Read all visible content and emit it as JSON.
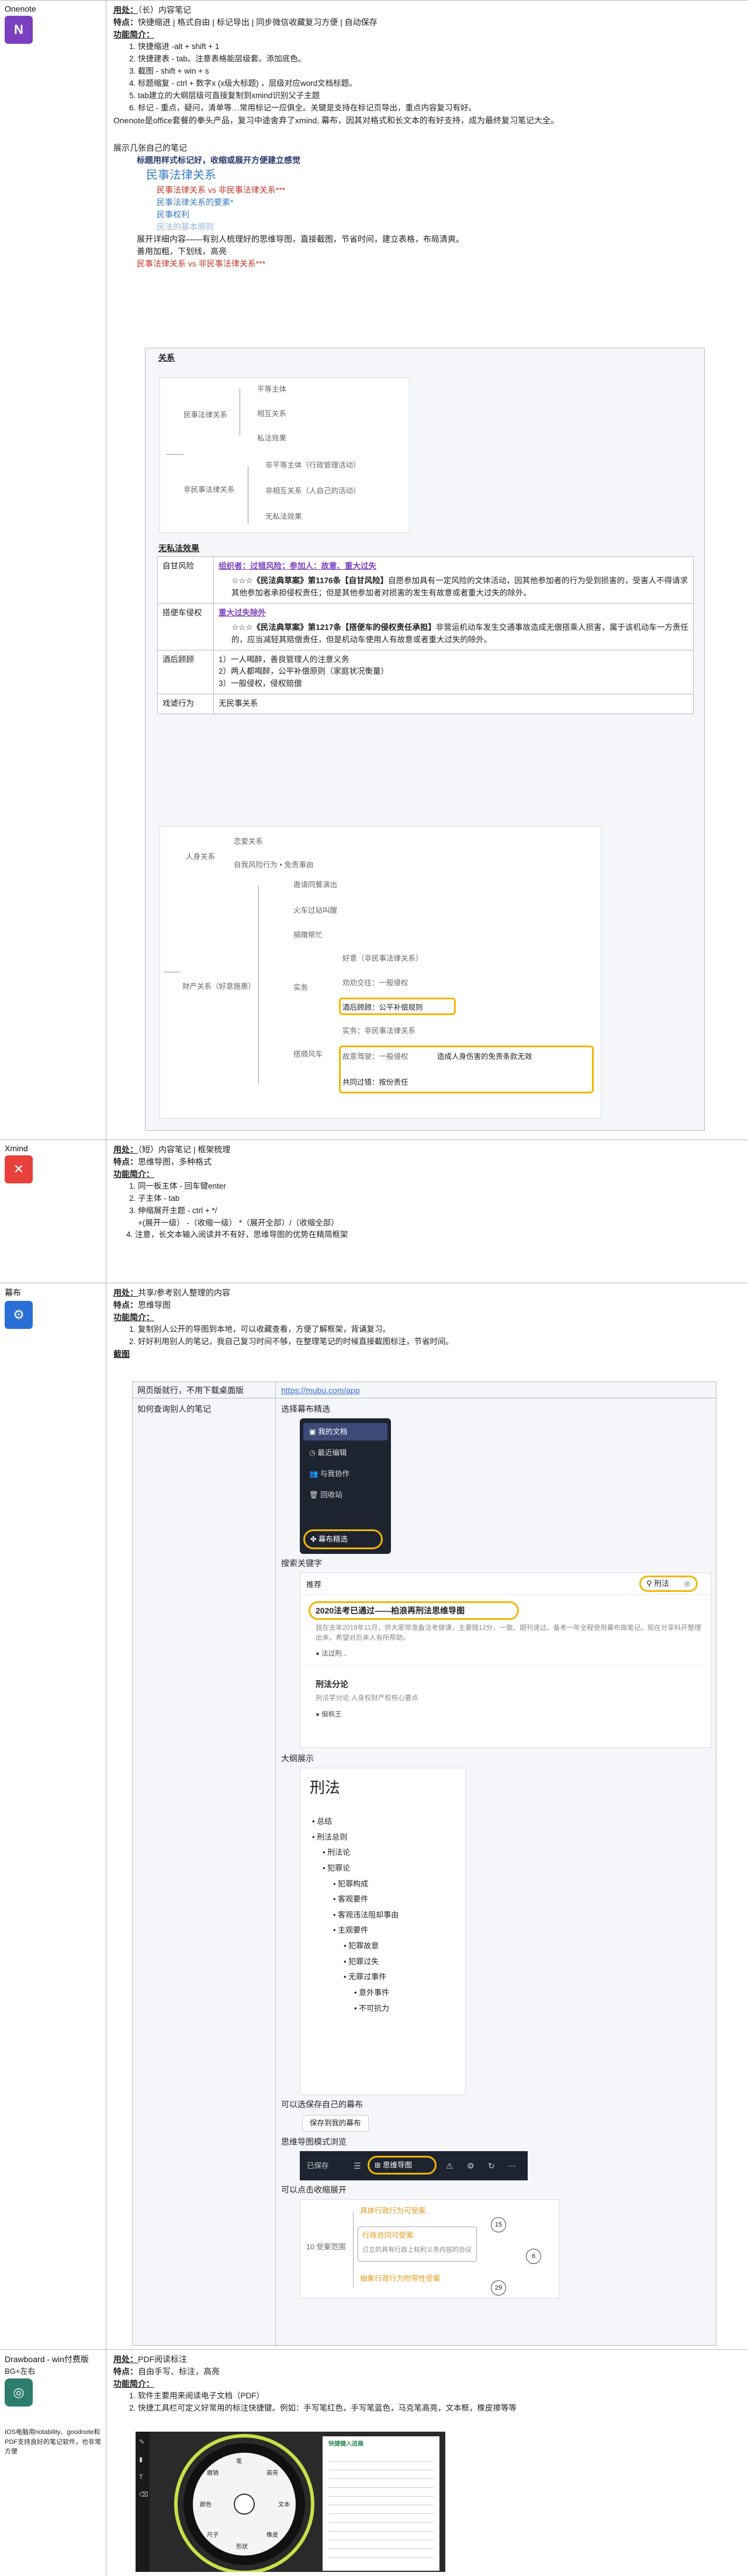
{
  "onenote": {
    "name": "Onenote",
    "icon_letter": "N",
    "usage_label": "用处：",
    "usage": "（长）内容笔记",
    "feature_label": "特点：",
    "feature": "快捷缩进 | 格式自由 | 标记导出 | 同步微信收藏复习方便 | 自动保存",
    "intro_label": "功能简介：",
    "items": [
      "快捷缩进 -alt + shift + 1",
      "快捷建表 - tab。注意表格能层级套。添加底色。",
      "截图 - shift + win + s",
      "标题缩复 - ctrl + 数字x (x级大标题) ，层级对应word文档标题。",
      "tab建立的大纲层级可直接复制到xmind识别父子主题",
      "标记 - 重点，疑问，清单等…常用标记一应俱全。关键是支持在标记页导出，重点内容复习有好。"
    ],
    "summary": "Onenote是office套餐的拳头产品，复习中途舍弃了xmind, 幕布，因其对格式和长文本的有好支持，成为最终复习笔记大全。",
    "demo_title": "展示几张自己的笔记",
    "demo_sub": "标题用样式标记好，收缩或展开方便建立感觉",
    "h1": "民事法律关系",
    "h2a": "民事法律关系 vs 非民事法律关系***",
    "h2b": "民事法律关系的要素*",
    "h2c": "民事权利",
    "h2d": "民法的基本原则",
    "para1": "展开详细内容——有别人梳理好的思维导图，直接截图，节省时间，建立表格，布局清爽。",
    "para2": "善用加粗，下划线，高亮",
    "h3": "民事法律关系 vs 非民事法律关系***",
    "t_rel": "关系",
    "mm1": {
      "root_a": "民事法律关系",
      "root_b": "非民事法律关系",
      "a1": "平等主体",
      "a2": "相互关系",
      "a3": "私法效果",
      "b1": "非平等主体（行政管理活动）",
      "b2": "非相互关系（人自己的活动）",
      "b3": "无私法效果"
    },
    "t_none": "无私法效果",
    "rows": [
      {
        "k": "自甘风险",
        "tag": "组织者：过错风险；参加人：故意、重大过失",
        "body_b": "☆☆☆《民法典草案》第1176条【自甘风险】",
        "body": "自愿参加具有一定风险的文体活动，因其他参加者的行为受到损害的，受害人不得请求其他参加者承担侵权责任；但是其他参加者对损害的发生有故意或者重大过失的除外。"
      },
      {
        "k": "搭便车侵权",
        "tag": "重大过失除外",
        "body_b": "☆☆☆《民法典草案》第1217条【搭便车的侵权责任承担】",
        "body": "非营运机动车发生交通事故造成无偿搭乘人损害，属于该机动车一方责任的，应当减轻其赔偿责任，但是机动车使用人有故意或者重大过失的除外。"
      },
      {
        "k": "酒后顾顾",
        "lines": [
          "1）一人喝醉，善良管理人的注意义务",
          "2）两人都喝醉，公平补偿原则（家庭状况衡量）",
          "3）一般侵权，侵权赔偿"
        ]
      },
      {
        "k": "戏谑行为",
        "plain": "无民事关系"
      }
    ],
    "mm2": {
      "n1": "恋爱关系",
      "n2": "人身关系",
      "n3": "自我风险行为 • 免责事由",
      "n4": "邀请同餐演出",
      "n5": "火车过站叫醒",
      "n6": "捐赠帮忙",
      "n7": "好意（非民事法律关系）",
      "n8": "财产关系（好意施惠）",
      "n9": "实务",
      "n10": "劝劝交往：一般侵权",
      "n11": "酒后顾顾：公平补偿规则",
      "n12": "实务：非民事法律关系",
      "n13": "搭顺风车",
      "n14": "故意驾驶：一般侵权",
      "n15": "造成人身伤害的免责条款无效",
      "n16": "共同过错：按份责任"
    }
  },
  "xmind": {
    "name": "Xmind",
    "usage_label": "用处：",
    "usage": "（短）内容笔记 | 框架梳理",
    "feature_label": "特点：",
    "feature": "思维导图，多种格式",
    "intro_label": "功能简介：",
    "items": [
      "同一板主体 - 回车键enter",
      "子主体 - tab",
      "伸缩展开主题 - ctrl + */"
    ],
    "extra1": "+(展开一级） -（收缩一级） *（展开全部）/（收缩全部）",
    "extra2": "注意，长文本输入阅读并不有好，思维导图的优势在精简框架",
    "extra2_num": "4."
  },
  "mubu": {
    "name": "幕布",
    "usage_label": "用处：",
    "usage": "共享/参考别人整理的内容",
    "feature_label": "特点：",
    "feature": "思维导图",
    "intro_label": "功能简介：",
    "items": [
      "复制别人公开的导图到本地，可以收藏查看，方便了解框架，背诵复习。",
      "好好利用别人的笔记，我自己复习时间不够，在整理笔记的时候直接截图标注，节省时间。"
    ],
    "shot_label": "截图",
    "c1": "网页版就行，不用下载桌面版",
    "link": "https://mubu.com/app",
    "c2": "如何查询别人的笔记",
    "s1": "选择幕布精选",
    "menu": [
      "我的文档",
      "最近编辑",
      "与我协作",
      "回收站",
      "幕布精选"
    ],
    "s2": "搜索关键字",
    "search_tab": "推荐",
    "search_val": "刑法",
    "r1_title": "2020法考已通过——柏浪再刑法思维导图",
    "r1_desc": "我在去年2019年11月，供大家带准备法考做课，主要随12分，一致。期刊速过。备考一年全程使用幕布做笔记。现在分享科开整理出来，希望对后来人有所帮助。",
    "r1_author": "法过刑...",
    "r2_title": "刑法分论",
    "r2_desc": "刑法学分论 人身权财产权核心要点",
    "r2_author": "偏枫王",
    "s3": "大纲展示",
    "outline_title": "刑法",
    "outline": [
      "总结",
      "刑法总则",
      "刑法论",
      "犯罪论",
      "犯罪构成",
      "客观要件",
      "客观违法阻却事由",
      "主观要件",
      "犯罪故意",
      "犯罪过失",
      "无罪过事件",
      "意外事件",
      "不可抗力"
    ],
    "s4": "可以选保存自己的幕布",
    "save_btn": "保存到我的幕布",
    "s5": "思维导图模式浏览",
    "mode_left": "已保存",
    "mode_btn": "思维导图",
    "s6": "可以点击收缩展开",
    "fold": {
      "a": "具体行政行为可受案",
      "b": "行政合同可受案",
      "c": "订立的具有行政上权利义务内容的协议",
      "d": "抽象行政行为附带性受案",
      "root": "10 受案范围",
      "n1": "15",
      "n2": "6",
      "n3": "29"
    }
  },
  "drawboard": {
    "name": "Drawboard - win付费版",
    "sub": "BG+左右",
    "note": "IOS电脑用notability、goodnote和PDF支持良好的笔记软件，也非常方便",
    "usage_label": "用处：",
    "usage": "PDF阅读标注",
    "feature_label": "特点：",
    "feature": "自由手写、标注，高亮",
    "intro_label": "功能简介：",
    "items": [
      "软件主要用来阅读电子文档（PDF）",
      "快捷工具栏可定义好常用的标注快捷键。例如：手写笔红色，手写笔蓝色，马克笔高亮，文本框，橡皮擦等等"
    ],
    "doc_title": "快捷键入进展",
    "wheel": [
      "笔",
      "高亮",
      "文本",
      "橡皮",
      "形状",
      "尺子",
      "颜色",
      "撤销"
    ]
  }
}
